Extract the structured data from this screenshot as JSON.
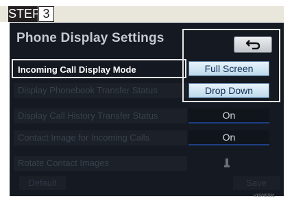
{
  "step": {
    "label": "STEP",
    "number": "3"
  },
  "screen": {
    "title": "Phone Display Settings",
    "back_icon": "back-arrow-icon",
    "rows": [
      {
        "label": "Incoming Call Display Mode",
        "options": [
          "Full Screen",
          "Drop Down"
        ]
      },
      {
        "label": "Display Phonebook Transfer Status"
      },
      {
        "label": "Display Call History Transfer Status",
        "value": "On"
      },
      {
        "label": "Contact Image for Incoming Calls",
        "value": "On"
      },
      {
        "label": "Rotate Contact Images"
      }
    ],
    "default_label": "Default",
    "save_label": "Save"
  },
  "image_code": "VX50ISS81",
  "colors": {
    "highlight_option": "#bcd9ec",
    "underline": "#1f3f86",
    "screen_bg": "#151a22"
  }
}
